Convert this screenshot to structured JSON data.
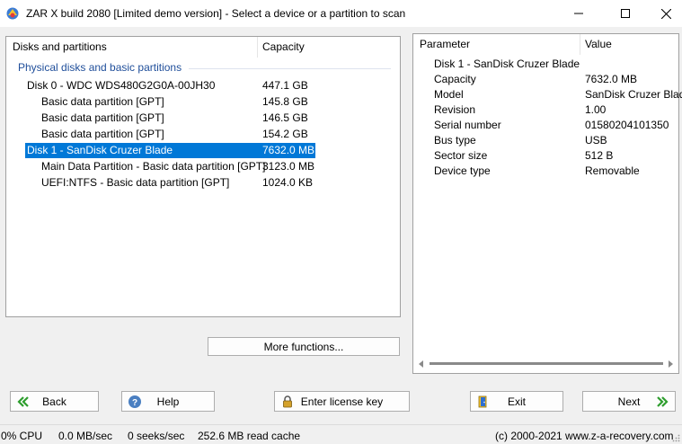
{
  "window": {
    "title": "ZAR X build 2080 [Limited demo version] - Select a device or a partition to scan"
  },
  "left_panel": {
    "col_name": "Disks and partitions",
    "col_capacity": "Capacity",
    "group_label": "Physical disks and basic partitions",
    "rows": [
      {
        "name": "Disk 0 - WDC WDS480G2G0A-00JH30",
        "capacity": "447.1 GB"
      },
      {
        "name": "Basic data partition [GPT]",
        "capacity": "145.8 GB"
      },
      {
        "name": "Basic data partition [GPT]",
        "capacity": "146.5 GB"
      },
      {
        "name": "Basic data partition [GPT]",
        "capacity": "154.2 GB"
      },
      {
        "name": "Disk 1 - SanDisk Cruzer Blade",
        "capacity": "7632.0 MB",
        "selected": true
      },
      {
        "name": "Main Data Partition - Basic data partition [GPT]",
        "capacity": "3123.0 MB"
      },
      {
        "name": "UEFI:NTFS - Basic data partition [GPT]",
        "capacity": "1024.0 KB"
      }
    ]
  },
  "right_panel": {
    "col_parameter": "Parameter",
    "col_value": "Value",
    "device_name": "Disk 1 - SanDisk Cruzer Blade",
    "params": [
      {
        "name": "Capacity",
        "value": "7632.0 MB"
      },
      {
        "name": "Model",
        "value": "SanDisk Cruzer Blade"
      },
      {
        "name": "Revision",
        "value": "1.00"
      },
      {
        "name": "Serial number",
        "value": "01580204101350"
      },
      {
        "name": "Bus type",
        "value": "USB"
      },
      {
        "name": "Sector size",
        "value": "512 B"
      },
      {
        "name": "Device type",
        "value": "Removable"
      }
    ]
  },
  "buttons": {
    "more_functions": "More functions...",
    "back": "Back",
    "help": "Help",
    "license": "Enter license key",
    "exit": "Exit",
    "next": "Next"
  },
  "status": {
    "cpu": "0% CPU",
    "speed": "0.0 MB/sec",
    "seeks": "0 seeks/sec",
    "cache": "252.6 MB read cache",
    "copyright": "(c) 2000-2021 www.z-a-recovery.com"
  },
  "colors": {
    "selection": "#0078d7",
    "group_header": "#1f4e9a",
    "arrow_green": "#2e9e2e"
  }
}
